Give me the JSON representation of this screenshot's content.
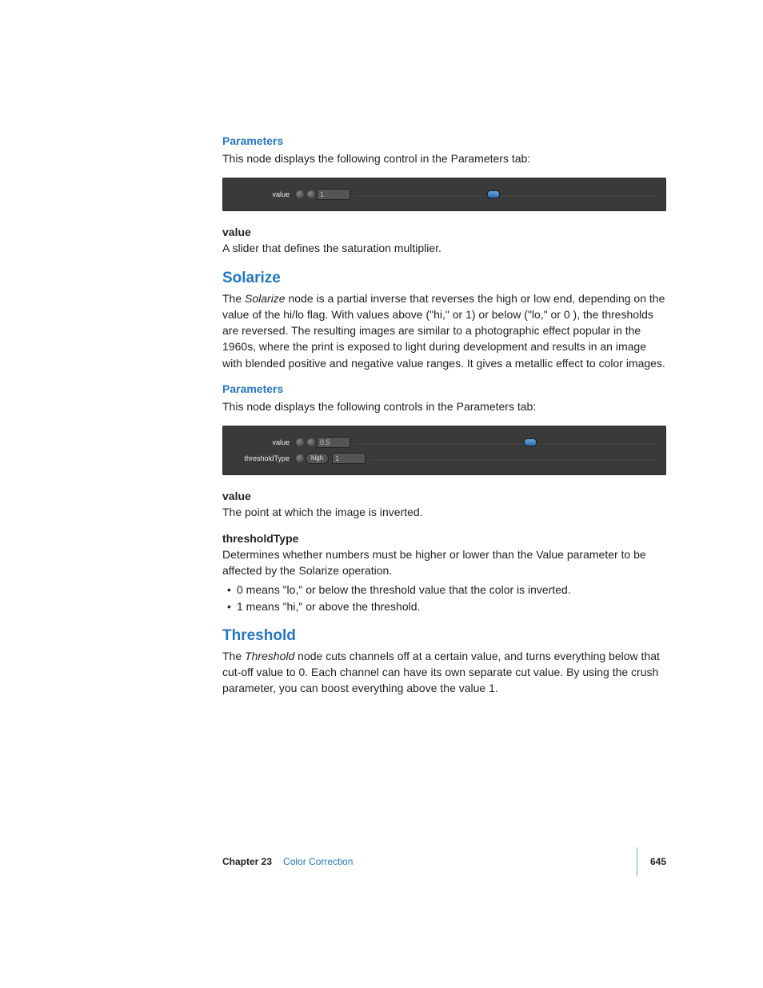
{
  "section1": {
    "heading": "Parameters",
    "intro": "This node displays the following control in the Parameters tab:",
    "panel": {
      "label": "value",
      "value": "1"
    },
    "param_name": "value",
    "param_desc": "A slider that defines the saturation multiplier."
  },
  "solarize": {
    "heading": "Solarize",
    "body_pre": "The ",
    "body_em": "Solarize",
    "body_post": " node is a partial inverse that reverses the high or low end, depending on the value of the hi/lo flag. With values above (\"hi,\" or 1) or below (\"lo,\" or 0 ), the thresholds are reversed. The resulting images are similar to a photographic effect popular in the 1960s, where the print is exposed to light during development and results in an image with blended positive and negative value ranges. It gives a metallic effect to color images.",
    "params_heading": "Parameters",
    "params_intro": "This node displays the following controls in the Parameters tab:",
    "panel": {
      "row1": {
        "label": "value",
        "value": "0.5"
      },
      "row2": {
        "label": "thresholdType",
        "tag": "high",
        "value": "1"
      }
    },
    "p_value_name": "value",
    "p_value_desc": "The point at which the image is inverted.",
    "p_thresh_name": "thresholdType",
    "p_thresh_desc": "Determines whether numbers must be higher or lower than the Value parameter to be affected by the Solarize operation.",
    "bullets": [
      "0 means \"lo,\" or below the threshold value that the color is inverted.",
      "1 means \"hi,\" or above the threshold."
    ]
  },
  "threshold": {
    "heading": "Threshold",
    "body_pre": "The ",
    "body_em": "Threshold",
    "body_post": " node cuts channels off at a certain value, and turns everything below that cut-off value to 0. Each channel can have its own separate cut value. By using the crush parameter, you can boost everything above the value 1."
  },
  "footer": {
    "chapter_label": "Chapter 23",
    "chapter_title": "Color Correction",
    "page_number": "645"
  }
}
